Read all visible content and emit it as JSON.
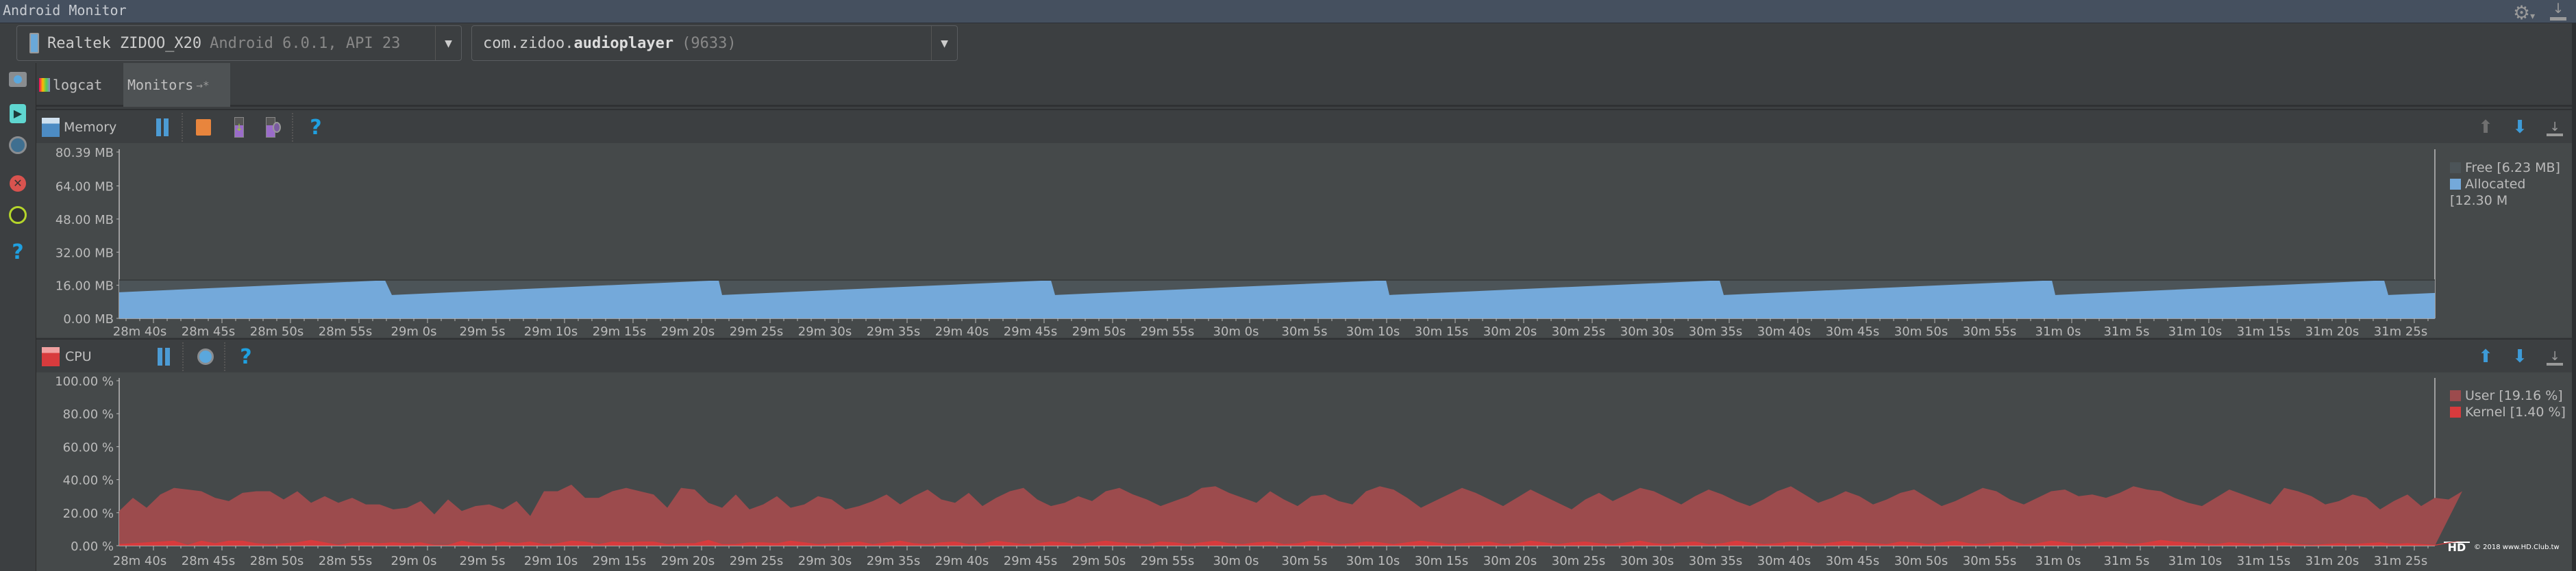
{
  "window": {
    "title": "Android Monitor"
  },
  "device": {
    "name": "Realtek ZIDOO_X20",
    "detail": "Android 6.0.1, API 23"
  },
  "process": {
    "prefix": "com.zidoo.",
    "name": "audioplayer",
    "pid": "(9633)"
  },
  "tabs": [
    {
      "label": "logcat"
    },
    {
      "label": "Monitors",
      "suffix": "→*"
    }
  ],
  "memory": {
    "label": "Memory",
    "legend": [
      {
        "label": "Free [6.23 MB]",
        "color": "#4c5458"
      },
      {
        "label": "Allocated [12.30 M",
        "color": "#74a9da"
      }
    ]
  },
  "cpu": {
    "label": "CPU",
    "legend": [
      {
        "label": "User [19.16 %]",
        "color": "#9c4b4d"
      },
      {
        "label": "Kernel [1.40 %]",
        "color": "#d83b3d"
      }
    ]
  },
  "watermark": {
    "logo": "HD CLUB",
    "text": "© 2018 www.HD.Club.tw"
  },
  "chart_data": [
    {
      "type": "area",
      "title": "Memory",
      "ylabel": "MB",
      "ylim": [
        0,
        80.39
      ],
      "yticks": [
        "0.00 MB",
        "16.00 MB",
        "32.00 MB",
        "48.00 MB",
        "64.00 MB",
        "80.39 MB"
      ],
      "ytick_values": [
        0,
        16,
        32,
        48,
        64,
        80.39
      ],
      "xlim_seconds": [
        1717.5,
        1886.5
      ],
      "xticks": [
        "28m 40s",
        "28m 45s",
        "28m 50s",
        "28m 55s",
        "29m 0s",
        "29m 5s",
        "29m 10s",
        "29m 15s",
        "29m 20s",
        "29m 25s",
        "29m 30s",
        "29m 35s",
        "29m 40s",
        "29m 45s",
        "29m 50s",
        "29m 55s",
        "30m 0s",
        "30m 5s",
        "30m 10s",
        "30m 15s",
        "30m 20s",
        "30m 25s",
        "30m 30s",
        "30m 35s",
        "30m 40s",
        "30m 45s",
        "30m 50s",
        "30m 55s",
        "31m 0s",
        "31m 5s",
        "31m 10s",
        "31m 15s",
        "31m 20s",
        "31m 25s"
      ],
      "series": [
        {
          "name": "Allocated",
          "points": [
            [
              1717.5,
              12.6
            ],
            [
              1736.9,
              18.4
            ],
            [
              1737.4,
              11.3
            ],
            [
              1761.25,
              18.4
            ],
            [
              1761.5,
              11.3
            ],
            [
              1785.5,
              18.4
            ],
            [
              1785.8,
              11.3
            ],
            [
              1809.95,
              18.4
            ],
            [
              1810.2,
              11.3
            ],
            [
              1834.3,
              18.4
            ],
            [
              1834.6,
              11.3
            ],
            [
              1858.55,
              18.4
            ],
            [
              1858.8,
              11.3
            ],
            [
              1882.8,
              18.4
            ],
            [
              1883.1,
              11.3
            ],
            [
              1886.5,
              12.3
            ]
          ]
        },
        {
          "name": "Free",
          "total": 18.53
        }
      ]
    },
    {
      "type": "area",
      "title": "CPU",
      "ylabel": "%",
      "ylim": [
        0,
        100
      ],
      "yticks": [
        "0.00 %",
        "20.00 %",
        "40.00 %",
        "60.00 %",
        "80.00 %",
        "100.00 %"
      ],
      "ytick_values": [
        0,
        20,
        40,
        60,
        80,
        100
      ],
      "x_start_seconds": 1717.5,
      "x_step_seconds": 1,
      "series": [
        {
          "name": "User",
          "values": [
            21,
            29,
            23,
            31,
            35,
            34,
            33,
            29,
            27,
            32,
            33,
            33,
            28,
            33,
            26,
            30,
            26,
            29,
            25,
            25,
            22,
            23,
            27,
            19,
            28,
            21,
            24,
            25,
            22,
            27,
            18,
            33,
            33,
            37,
            29,
            29,
            33,
            35,
            33,
            31,
            23,
            35,
            34,
            26,
            23,
            31,
            22,
            25,
            30,
            23,
            25,
            30,
            28,
            22,
            24,
            27,
            31,
            25,
            30,
            34,
            28,
            26,
            32,
            24,
            29,
            33,
            35,
            28,
            24,
            26,
            30,
            27,
            33,
            35,
            31,
            28,
            24,
            27,
            30,
            35,
            36,
            32,
            29,
            26,
            33,
            28,
            24,
            30,
            31,
            27,
            25,
            33,
            36,
            34,
            29,
            23,
            27,
            31,
            35,
            32,
            28,
            24,
            29,
            34,
            30,
            26,
            22,
            28,
            32,
            27,
            31,
            35,
            33,
            29,
            25,
            30,
            34,
            31,
            27,
            24,
            28,
            33,
            36,
            31,
            26,
            29,
            33,
            30,
            25,
            28,
            32,
            34,
            29,
            24,
            27,
            31,
            35,
            33,
            28,
            25,
            29,
            33,
            34,
            30,
            31,
            29,
            32,
            36,
            34,
            33,
            29,
            26,
            24,
            29,
            34,
            31,
            28,
            25,
            35,
            33,
            30,
            25,
            27,
            31,
            29,
            22,
            27,
            31,
            24,
            29,
            28,
            33
          ]
        },
        {
          "name": "Kernel",
          "values": [
            1,
            1.5,
            2,
            2.5,
            3,
            0.5,
            3,
            1.5,
            3,
            3,
            1.5,
            1,
            1.5,
            2,
            3.5,
            2,
            0.5,
            2,
            2,
            1.5,
            2,
            1.5,
            2,
            0.5,
            0.5,
            3,
            1.5,
            1,
            2.5,
            1.5,
            2.5,
            1,
            1.5,
            3,
            2.5,
            1,
            2.5,
            2,
            2.5,
            2.5,
            1,
            1.5,
            1.5,
            3.5,
            1,
            1,
            2,
            2,
            1.5,
            3,
            2,
            1,
            1.5,
            2,
            2.5,
            1,
            2,
            3,
            1.5,
            1,
            2,
            2.5,
            1,
            1.5,
            3,
            2,
            1,
            1.5,
            2.5,
            2,
            1,
            2,
            3,
            2,
            1.5,
            1,
            2.5,
            2,
            1,
            2,
            3,
            1.5,
            1,
            2,
            2.5,
            1,
            1.5,
            3,
            2,
            1,
            1.5,
            2.5,
            2,
            1,
            2,
            3,
            2,
            1,
            1.5,
            2,
            2.5,
            1,
            1.5,
            3,
            2,
            1,
            2,
            2.5,
            1.5,
            1,
            2,
            3,
            1.5,
            1,
            2,
            2.5,
            1,
            1.5,
            3,
            2,
            1,
            1.5,
            2.5,
            2,
            1,
            2,
            3,
            2,
            1.5,
            1,
            2.5,
            2,
            1,
            2,
            3,
            1.5,
            1,
            2,
            2.5,
            1,
            1.5,
            3,
            2,
            1,
            1.5,
            2.5,
            2,
            1,
            2,
            3.5,
            2.5,
            2,
            1.5,
            1,
            2,
            1.5,
            1,
            1.5,
            2,
            1,
            0.5,
            1,
            1.5,
            1,
            1.5,
            2,
            1,
            1.5,
            1,
            0.5,
            2,
            3
          ]
        }
      ]
    }
  ]
}
